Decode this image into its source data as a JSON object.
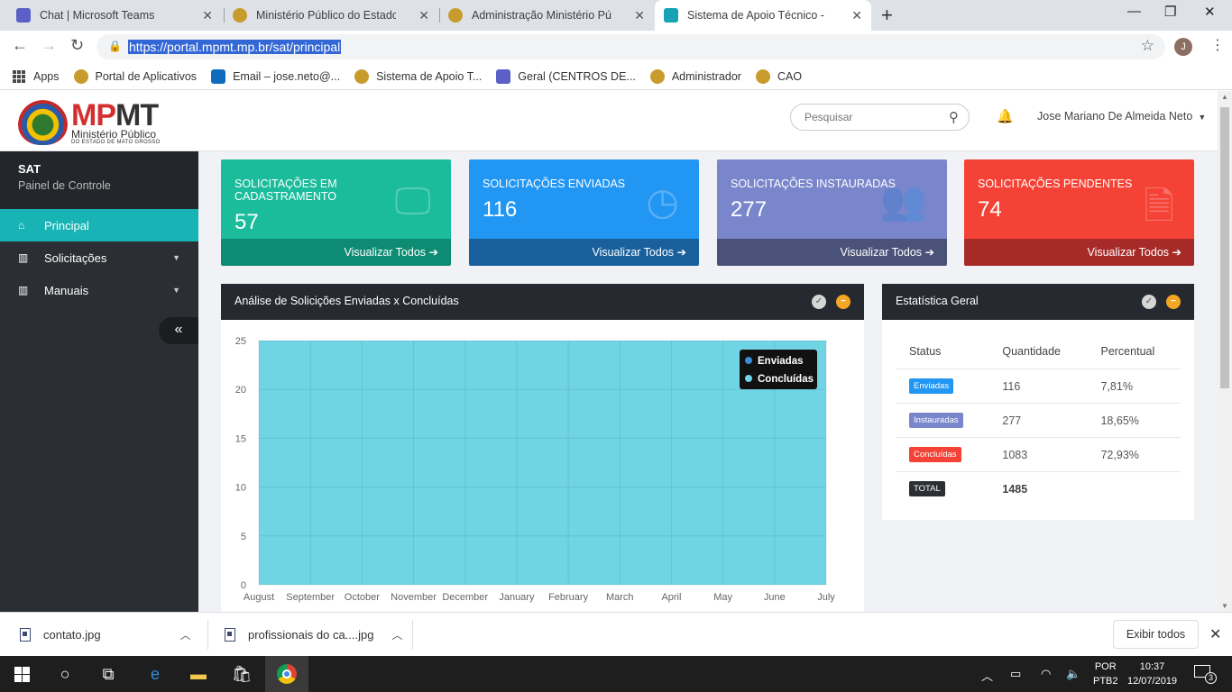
{
  "browser": {
    "tabs": [
      {
        "title": "Chat | Microsoft Teams",
        "icon": "teams-icon",
        "color": "#5b5fc7"
      },
      {
        "title": "Ministério Público do Estado de",
        "icon": "mpmt-crest-icon",
        "color": "#c89b2d"
      },
      {
        "title": "Administração Ministério Público",
        "icon": "mpmt-crest-icon",
        "color": "#c89b2d"
      },
      {
        "title": "Sistema de Apoio Técnico - CAO",
        "icon": "sat-app-icon",
        "color": "#19a1b5"
      }
    ],
    "url": "https://portal.mpmt.mp.br/sat/principal",
    "profile_initial": "J",
    "bookmarks": [
      {
        "label": "Apps",
        "icon": "apps-grid-icon"
      },
      {
        "label": "Portal de Aplicativos",
        "icon": "mpmt-crest-icon"
      },
      {
        "label": "Email – jose.neto@...",
        "icon": "outlook-icon"
      },
      {
        "label": "Sistema de Apoio T...",
        "icon": "mpmt-crest-icon"
      },
      {
        "label": "Geral (CENTROS DE...",
        "icon": "teams-icon"
      },
      {
        "label": "Administrador",
        "icon": "mpmt-crest-icon"
      },
      {
        "label": "CAO",
        "icon": "mpmt-crest-icon"
      }
    ]
  },
  "header": {
    "brand_mp": "MP",
    "brand_mt": "MT",
    "brand_sub": "Ministério Público",
    "brand_sub2": "DO ESTADO DE MATO GROSSO",
    "search_placeholder": "Pesquisar",
    "user_name": "Jose Mariano De Almeida Neto"
  },
  "sidebar": {
    "title": "SAT",
    "subtitle": "Painel de Controle",
    "items": [
      {
        "label": "Principal",
        "icon": "home-icon"
      },
      {
        "label": "Solicitações",
        "icon": "bar-chart-icon"
      },
      {
        "label": "Manuais",
        "icon": "bar-chart-icon"
      }
    ],
    "collapse_glyph": "«"
  },
  "cards": [
    {
      "label": "SOLICITAÇÕES EM CADASTRAMENTO",
      "value": "57",
      "link": "Visualizar Todos",
      "icon": "monitor-icon",
      "color": "#1abc9c",
      "footer_color": "#0e8c73"
    },
    {
      "label": "SOLICITAÇÕES ENVIADAS",
      "value": "116",
      "link": "Visualizar Todos",
      "icon": "clock-icon",
      "color": "#2196f3",
      "footer_color": "#19609d"
    },
    {
      "label": "SOLICITAÇÕES INSTAURADAS",
      "value": "277",
      "link": "Visualizar Todos",
      "icon": "users-icon",
      "color": "#7986cb",
      "footer_color": "#4b527a"
    },
    {
      "label": "SOLICITAÇÕES PENDENTES",
      "value": "74",
      "link": "Visualizar Todos",
      "icon": "document-icon",
      "color": "#f44336",
      "footer_color": "#a62b28"
    }
  ],
  "chart_panel": {
    "title": "Análise de Solicições Enviadas x Concluídas"
  },
  "stats_panel": {
    "title": "Estatística Geral",
    "headers": [
      "Status",
      "Quantidade",
      "Percentual"
    ],
    "rows": [
      {
        "status": "Enviadas",
        "qty": "116",
        "pct": "7,81%",
        "color": "#2196f3"
      },
      {
        "status": "Instauradas",
        "qty": "277",
        "pct": "18,65%",
        "color": "#7986cb"
      },
      {
        "status": "Concluídas",
        "qty": "1083",
        "pct": "72,93%",
        "color": "#f44336"
      },
      {
        "status": "TOTAL",
        "qty": "1485",
        "pct": "",
        "color": "#2b2e33"
      }
    ]
  },
  "chart_data": {
    "type": "area",
    "categories": [
      "August",
      "September",
      "October",
      "November",
      "December",
      "January",
      "February",
      "March",
      "April",
      "May",
      "June",
      "July"
    ],
    "series": [
      {
        "name": "Enviadas",
        "values": [
          25,
          25,
          25,
          25,
          25,
          25,
          25,
          25,
          25,
          25,
          25,
          25
        ],
        "color": "#3a8fd6"
      },
      {
        "name": "Concluídas",
        "values": [
          25,
          25,
          25,
          25,
          25,
          25,
          25,
          25,
          25,
          25,
          25,
          25
        ],
        "color": "#6fd4e4"
      }
    ],
    "ylim": [
      0,
      25
    ],
    "yticks": [
      0,
      5,
      10,
      15,
      20,
      25
    ],
    "grid": true,
    "legend": "top-right"
  },
  "downloads": {
    "items": [
      "contato.jpg",
      "profissionais do ca....jpg"
    ],
    "show_all": "Exibir todos"
  },
  "taskbar": {
    "lang1": "POR",
    "lang2": "PTB2",
    "time": "10:37",
    "date": "12/07/2019",
    "notifications": "3"
  }
}
